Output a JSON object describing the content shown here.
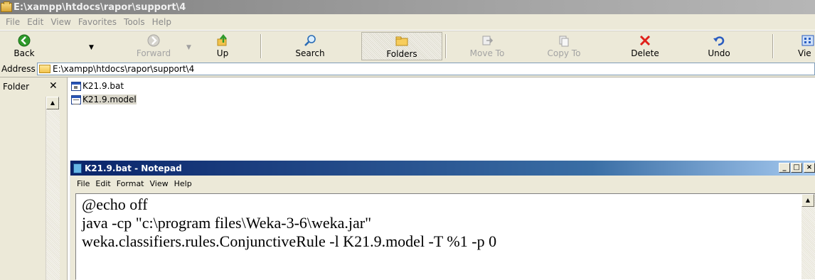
{
  "window": {
    "title": "E:\\xampp\\htdocs\\rapor\\support\\4"
  },
  "menu": [
    "File",
    "Edit",
    "View",
    "Favorites",
    "Tools",
    "Help"
  ],
  "toolbar": {
    "back": "Back",
    "forward": "Forward",
    "up": "Up",
    "search": "Search",
    "folders": "Folders",
    "move_to": "Move To",
    "copy_to": "Copy To",
    "delete": "Delete",
    "undo": "Undo",
    "views": "Vie"
  },
  "address": {
    "label": "Address",
    "value": "E:\\xampp\\htdocs\\rapor\\support\\4"
  },
  "folders_pane": {
    "title": "Folder",
    "close": "✕"
  },
  "files": [
    {
      "name": "K21.9.bat"
    },
    {
      "name": "K21.9.model"
    }
  ],
  "notepad": {
    "title": "K21.9.bat - Notepad",
    "menu": [
      "File",
      "Edit",
      "Format",
      "View",
      "Help"
    ],
    "lines": [
      "@echo off",
      "java -cp \"c:\\program files\\Weka-3-6\\weka.jar\"",
      "weka.classifiers.rules.ConjunctiveRule -l K21.9.model -T %1 -p 0"
    ]
  },
  "colors": {
    "inactive_title": "#8e8e8e",
    "notepad_title": "#0a246a",
    "delete_red": "#e0201a",
    "nav_green": "#2e9a2a"
  }
}
